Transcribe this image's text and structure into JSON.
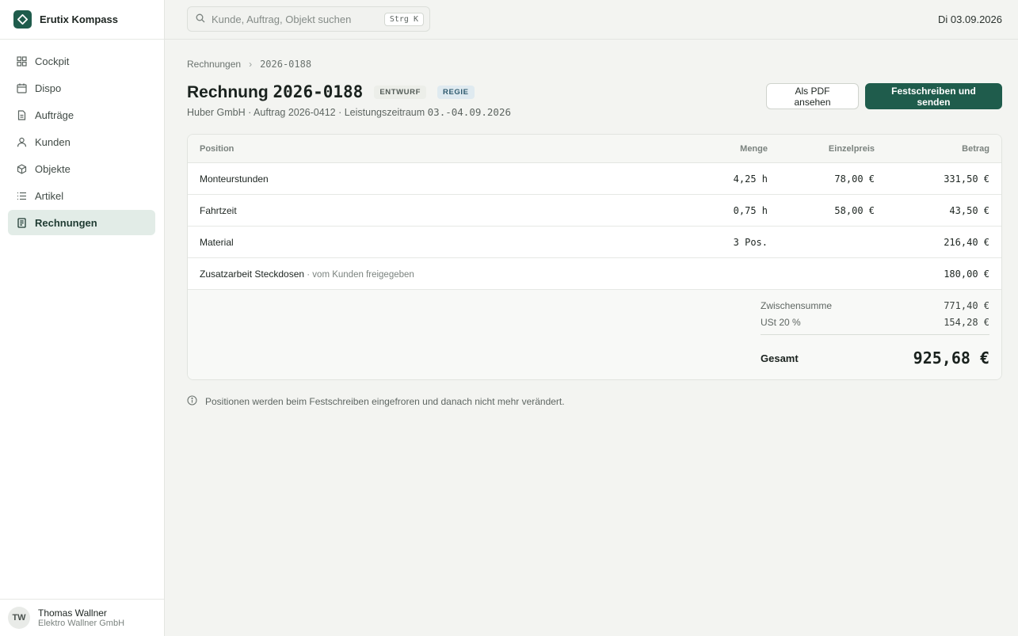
{
  "app": {
    "name": "Erutix Kompass"
  },
  "sidebar": {
    "items": [
      {
        "label": "Cockpit",
        "icon": "grid-icon"
      },
      {
        "label": "Dispo",
        "icon": "calendar-icon"
      },
      {
        "label": "Aufträge",
        "icon": "document-icon"
      },
      {
        "label": "Kunden",
        "icon": "person-icon"
      },
      {
        "label": "Objekte",
        "icon": "cube-icon"
      },
      {
        "label": "Artikel",
        "icon": "list-icon"
      },
      {
        "label": "Rechnungen",
        "icon": "invoice-icon",
        "active": true
      }
    ],
    "user": {
      "initials": "TW",
      "name": "Thomas Wallner",
      "org": "Elektro Wallner GmbH"
    }
  },
  "topbar": {
    "search_placeholder": "Kunde, Auftrag, Objekt suchen",
    "shortcut": "Strg K",
    "date": "Di 03.09.2026"
  },
  "breadcrumb": {
    "parent": "Rechnungen",
    "separator": "›",
    "current": "2026-0188"
  },
  "invoice": {
    "title_prefix": "Rechnung",
    "number": "2026-0188",
    "badges": {
      "status": "ENTWURF",
      "type": "REGIE"
    },
    "subtitle_text": "Huber GmbH · Auftrag 2026-0412 · Leistungszeitraum",
    "subtitle_period": "03.-04.09.2026",
    "actions": {
      "pdf": "Als PDF ansehen",
      "finalize": "Festschreiben und senden"
    },
    "columns": {
      "position": "Position",
      "qty": "Menge",
      "unit_price": "Einzelpreis",
      "amount": "Betrag"
    },
    "rows": [
      {
        "position": "Monteurstunden",
        "note": "",
        "qty": "4,25 h",
        "unit_price": "78,00 €",
        "amount": "331,50 €"
      },
      {
        "position": "Fahrtzeit",
        "note": "",
        "qty": "0,75 h",
        "unit_price": "58,00 €",
        "amount": "43,50 €"
      },
      {
        "position": "Material",
        "note": "",
        "qty": "3 Pos.",
        "unit_price": "",
        "amount": "216,40 €"
      },
      {
        "position": "Zusatzarbeit Steckdosen",
        "note": " · vom Kunden freigegeben",
        "qty": "",
        "unit_price": "",
        "amount": "180,00 €"
      }
    ],
    "totals": {
      "subtotal_label": "Zwischensumme",
      "subtotal": "771,40 €",
      "vat_label": "USt 20 %",
      "vat": "154,28 €",
      "total_label": "Gesamt",
      "total": "925,68 €"
    },
    "info_note": "Positionen werden beim Festschreiben eingefroren und danach nicht mehr verändert."
  },
  "colors": {
    "accent": "#1f5c4c",
    "active_nav_bg": "#e2ece7"
  }
}
